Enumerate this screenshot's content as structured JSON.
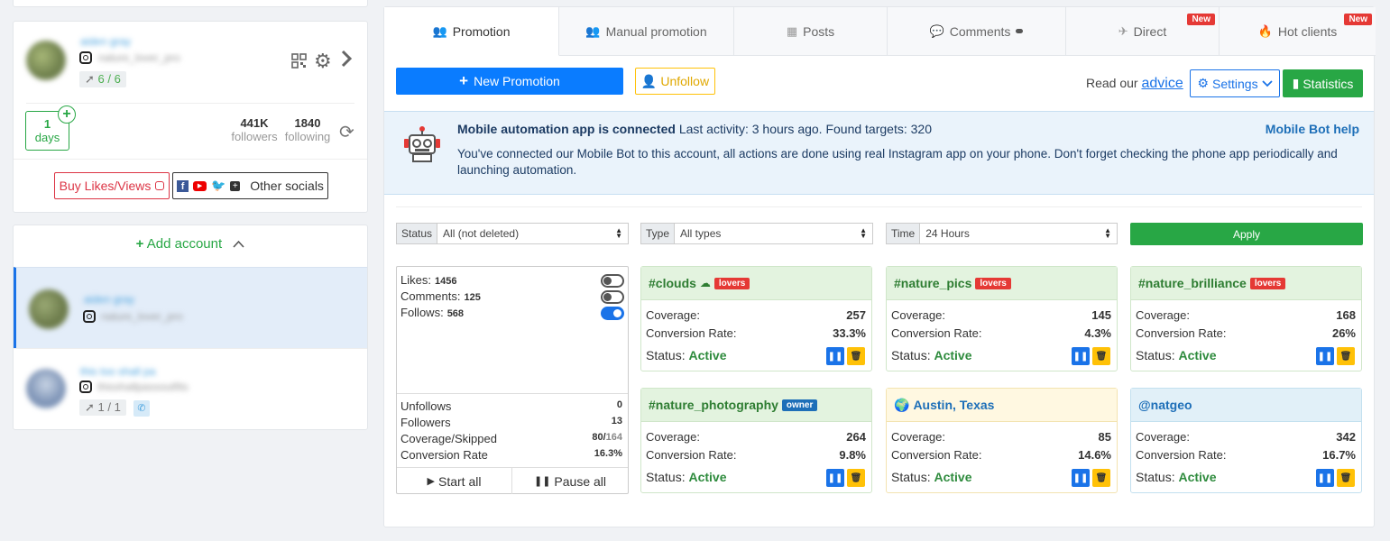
{
  "accounts": {
    "primary": {
      "name": "aiden gray",
      "handle": "nature_lover_pro",
      "rocket": "6 / 6",
      "days_num": "1",
      "days_label": "days",
      "followers_num": "441K",
      "followers_label": "followers",
      "following_num": "1840",
      "following_label": "following",
      "buy_label": "Buy Likes/Views",
      "other_label": "Other socials"
    },
    "add_label": "Add account",
    "list": [
      {
        "name": "aiden gray",
        "handle": "nature_lover_pro"
      },
      {
        "name": "this too shall pa",
        "handle": "thisshallpassoutfits",
        "rocket": "1 / 1"
      }
    ]
  },
  "tabs": [
    {
      "label": "Promotion"
    },
    {
      "label": "Manual promotion"
    },
    {
      "label": "Posts"
    },
    {
      "label": "Comments"
    },
    {
      "label": "Direct",
      "badge": "New"
    },
    {
      "label": "Hot clients",
      "badge": "New"
    }
  ],
  "toolbar": {
    "new_promotion": "New Promotion",
    "unfollow": "Unfollow",
    "read_our": "Read our",
    "advice": "advice",
    "settings": "Settings",
    "statistics": "Statistics"
  },
  "alert": {
    "title": "Mobile automation app is connected",
    "activity": "Last activity: 3 hours ago. Found targets: 320",
    "help": "Mobile Bot help",
    "body": "You've connected our Mobile Bot to this account, all actions are done using real Instagram app on your phone. Don't forget checking the phone app periodically and launching automation."
  },
  "filters": {
    "status_label": "Status",
    "status_value": "All (not deleted)",
    "type_label": "Type",
    "type_value": "All types",
    "time_label": "Time",
    "time_value": "24 Hours",
    "apply": "Apply"
  },
  "stats": {
    "likes_label": "Likes:",
    "likes": "1456",
    "likes_on": false,
    "comments_label": "Comments:",
    "comments": "125",
    "comments_on": false,
    "follows_label": "Follows:",
    "follows": "568",
    "follows_on": true,
    "unfollows_label": "Unfollows",
    "unfollows": "0",
    "followers_label": "Followers",
    "followers": "13",
    "coverage_label": "Coverage/Skipped",
    "coverage": "80",
    "skipped": "164",
    "conv_label": "Conversion Rate",
    "conv": "16.3%",
    "start_all": "Start all",
    "pause_all": "Pause all"
  },
  "target_labels": {
    "coverage": "Coverage:",
    "conversion": "Conversion Rate:",
    "status": "Status:"
  },
  "targets": [
    {
      "name": "#clouds",
      "tag": "lovers",
      "coverage": "257",
      "conversion": "33.3%",
      "status": "Active"
    },
    {
      "name": "#nature_pics",
      "tag": "lovers",
      "coverage": "145",
      "conversion": "4.3%",
      "status": "Active"
    },
    {
      "name": "#nature_brilliance",
      "tag": "lovers",
      "coverage": "168",
      "conversion": "26%",
      "status": "Active"
    },
    {
      "name": "#nature_photography",
      "tag": "owner",
      "coverage": "264",
      "conversion": "9.8%",
      "status": "Active"
    },
    {
      "name": "Austin, Texas",
      "tag": "",
      "coverage": "85",
      "conversion": "14.6%",
      "status": "Active"
    },
    {
      "name": "@natgeo",
      "tag": "",
      "coverage": "342",
      "conversion": "16.7%",
      "status": "Active"
    }
  ],
  "colors": {
    "primary_blue": "#0a7cff",
    "green": "#28a745",
    "warning": "#ffc107",
    "danger": "#e53935",
    "tag_lovers": "#e53935",
    "tag_owner": "#1e6fb8",
    "card_green_bg": "#e3f3df",
    "card_yellow_bg": "#fff8e1",
    "card_blue_bg": "#e1f0f8",
    "alert_bg": "#eaf3fb"
  }
}
